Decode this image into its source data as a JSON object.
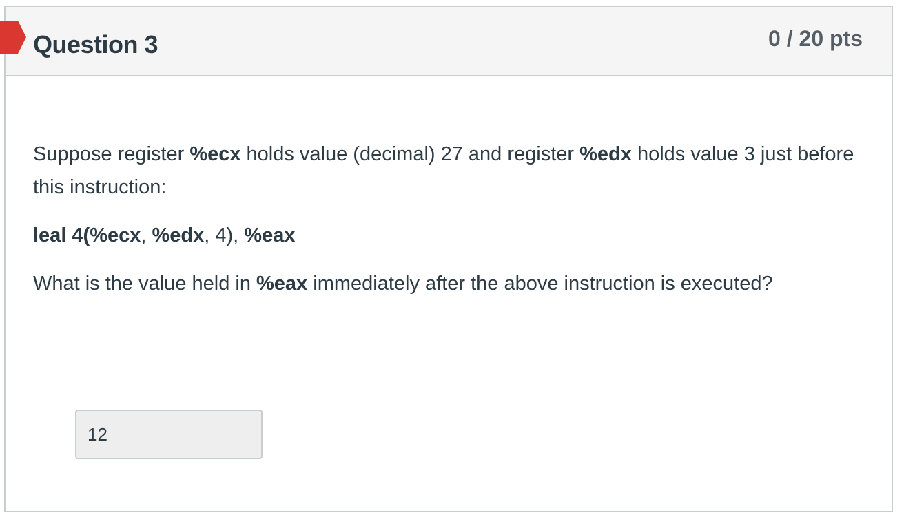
{
  "question": {
    "title": "Question 3",
    "points": "0 / 20 pts",
    "status_color": "#d9372f",
    "intro": {
      "t1": "Suppose register ",
      "reg1": "%ecx",
      "t2": " holds value (decimal) 27 and register ",
      "reg2": "%edx",
      "t3": " holds value 3 just before this instruction:"
    },
    "instruction": {
      "op": "leal 4(%ecx",
      "sep1": ", ",
      "reg": "%edx",
      "sep2": ", 4), ",
      "dest": "%eax"
    },
    "prompt": {
      "t1": "What is the value held in ",
      "reg": "%eax",
      "t2": " immediately after the above instruction is executed?"
    },
    "answer": {
      "value": "12"
    }
  }
}
